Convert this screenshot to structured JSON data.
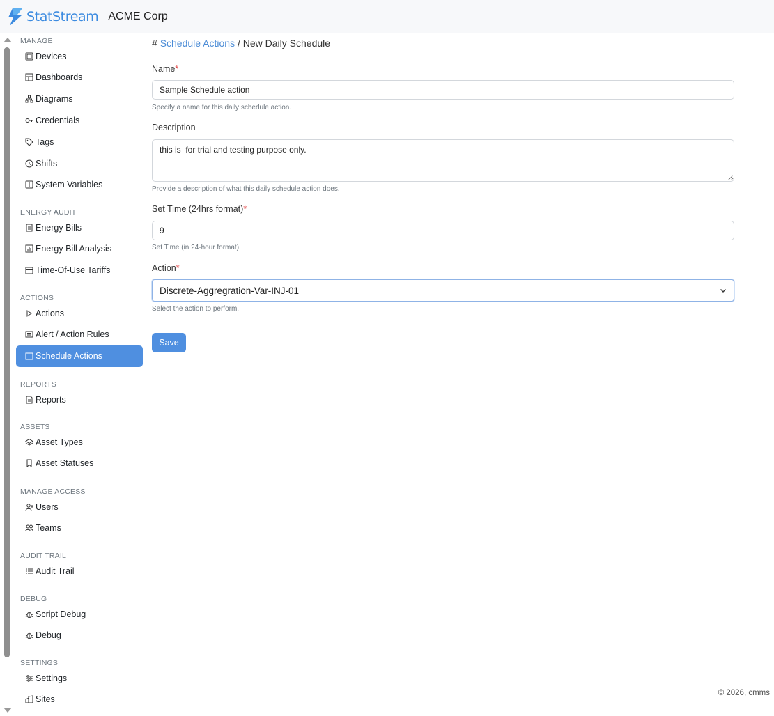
{
  "brand": {
    "name": "StatStream",
    "org": "ACME Corp",
    "accent": "#3c8be0"
  },
  "sidebar": {
    "sections": [
      {
        "title": "MANAGE",
        "items": [
          {
            "label": "Devices",
            "icon": "device-icon"
          },
          {
            "label": "Dashboards",
            "icon": "dashboard-icon"
          },
          {
            "label": "Diagrams",
            "icon": "diagram-icon"
          },
          {
            "label": "Credentials",
            "icon": "key-icon"
          },
          {
            "label": "Tags",
            "icon": "tag-icon"
          },
          {
            "label": "Shifts",
            "icon": "clock-icon"
          },
          {
            "label": "System Variables",
            "icon": "variable-icon"
          }
        ]
      },
      {
        "title": "ENERGY AUDIT",
        "items": [
          {
            "label": "Energy Bills",
            "icon": "bill-icon"
          },
          {
            "label": "Energy Bill Analysis",
            "icon": "chart-icon"
          },
          {
            "label": "Time-Of-Use Tariffs",
            "icon": "calendar-icon"
          }
        ]
      },
      {
        "title": "ACTIONS",
        "items": [
          {
            "label": "Actions",
            "icon": "play-icon"
          },
          {
            "label": "Alert / Action Rules",
            "icon": "rules-icon"
          },
          {
            "label": "Schedule Actions",
            "icon": "calendar-icon",
            "active": true
          }
        ]
      },
      {
        "title": "REPORTS",
        "items": [
          {
            "label": "Reports",
            "icon": "report-icon"
          }
        ]
      },
      {
        "title": "ASSETS",
        "items": [
          {
            "label": "Asset Types",
            "icon": "layers-icon"
          },
          {
            "label": "Asset Statuses",
            "icon": "bookmark-icon"
          }
        ]
      },
      {
        "title": "MANAGE ACCESS",
        "items": [
          {
            "label": "Users",
            "icon": "user-add-icon"
          },
          {
            "label": "Teams",
            "icon": "team-icon"
          }
        ]
      },
      {
        "title": "AUDIT TRAIL",
        "items": [
          {
            "label": "Audit Trail",
            "icon": "list-icon"
          }
        ]
      },
      {
        "title": "DEBUG",
        "items": [
          {
            "label": "Script Debug",
            "icon": "bug-icon"
          },
          {
            "label": "Debug",
            "icon": "bug-icon"
          }
        ]
      },
      {
        "title": "SETTINGS",
        "items": [
          {
            "label": "Settings",
            "icon": "sliders-icon"
          },
          {
            "label": "Sites",
            "icon": "building-icon"
          }
        ]
      }
    ]
  },
  "breadcrumb": {
    "hash": "#",
    "parent": "Schedule Actions",
    "separator": "/",
    "current": "New Daily Schedule"
  },
  "form": {
    "name": {
      "label": "Name",
      "required_mark": "*",
      "value": "Sample Schedule action",
      "help": "Specify a name for this daily schedule action."
    },
    "description": {
      "label": "Description",
      "value": "this is  for trial and testing purpose only.",
      "help": "Provide a description of what this daily schedule action does."
    },
    "time": {
      "label": "Set Time (24hrs format)",
      "required_mark": "*",
      "value": "9",
      "help": "Set Time (in 24-hour format)."
    },
    "action": {
      "label": "Action",
      "required_mark": "*",
      "value": "Discrete-Aggregration-Var-INJ-01",
      "help": "Select the action to perform."
    },
    "save_label": "Save"
  },
  "footer": {
    "text": "© 2026, cmms"
  }
}
